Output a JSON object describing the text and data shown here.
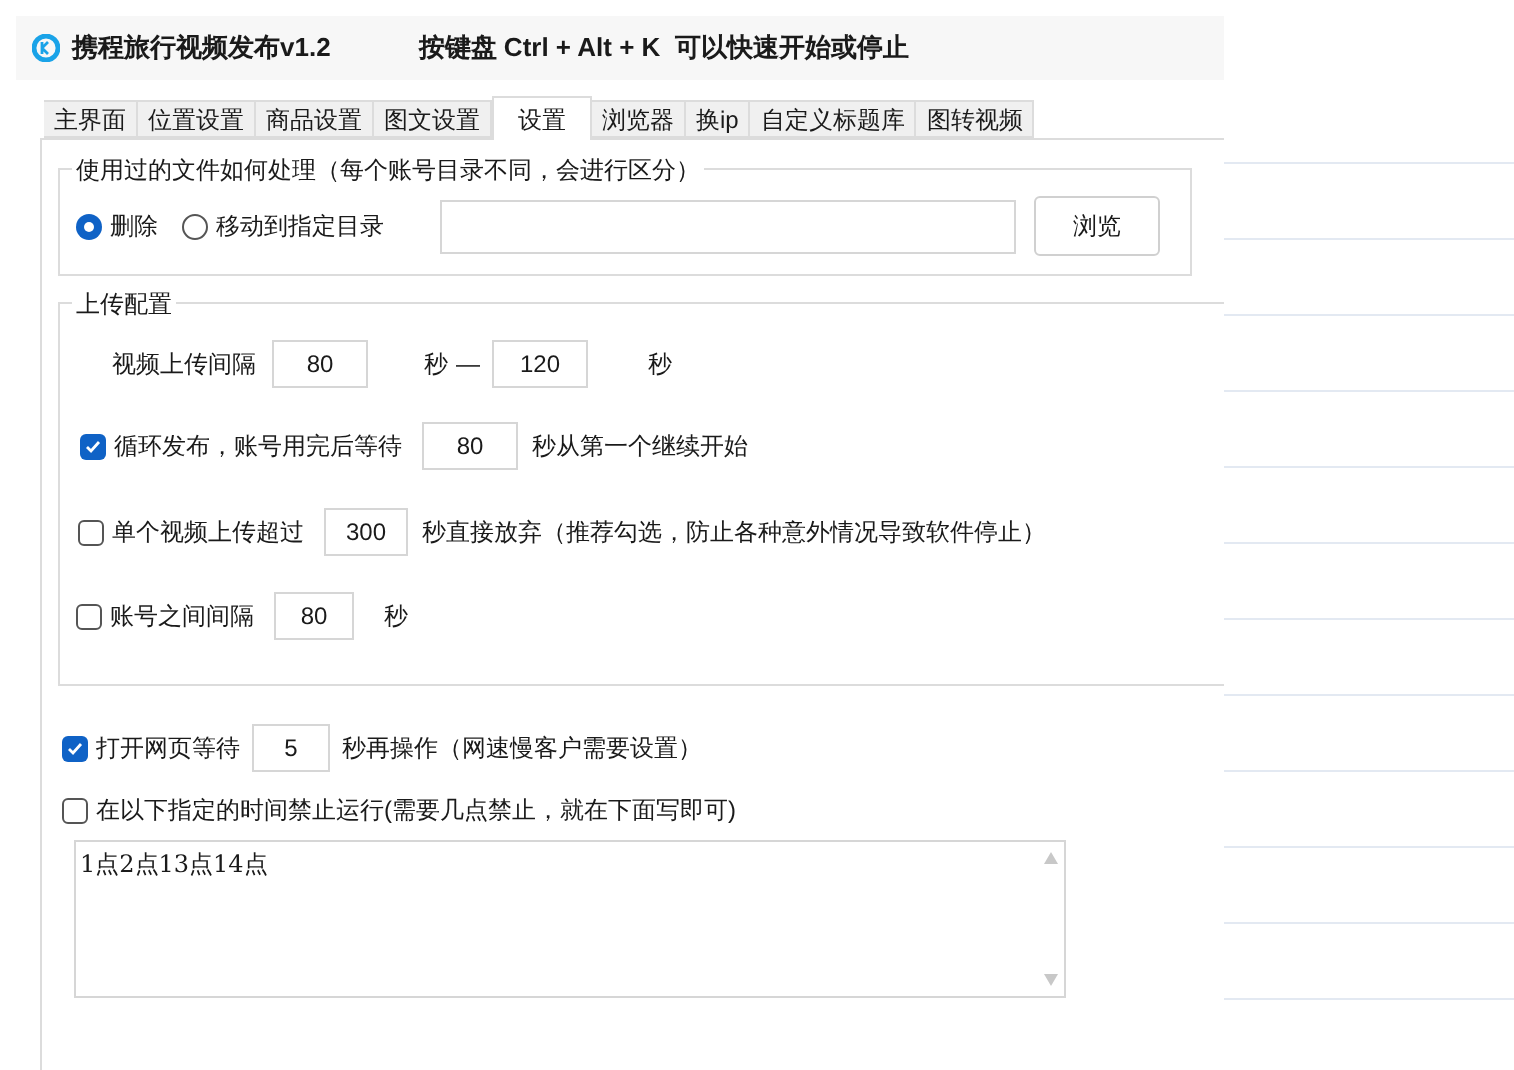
{
  "window": {
    "title": "携程旅行视频发布v1.2",
    "hotkey_hint": "按键盘 Ctrl + Alt + K  可以快速开始或停止"
  },
  "tabs": [
    {
      "label": "主界面",
      "selected": false
    },
    {
      "label": "位置设置",
      "selected": false
    },
    {
      "label": "商品设置",
      "selected": false
    },
    {
      "label": "图文设置",
      "selected": false
    },
    {
      "label": "设置",
      "selected": true
    },
    {
      "label": "浏览器",
      "selected": false
    },
    {
      "label": "换ip",
      "selected": false
    },
    {
      "label": "自定义标题库",
      "selected": false
    },
    {
      "label": "图转视频",
      "selected": false
    }
  ],
  "used_files": {
    "legend": "使用过的文件如何处理（每个账号目录不同，会进行区分）",
    "options": [
      {
        "label": "删除",
        "selected": true
      },
      {
        "label": "移动到指定目录",
        "selected": false
      }
    ],
    "browse_button": "浏览"
  },
  "upload_config": {
    "legend": "上传配置",
    "rows": [
      {
        "kind": "range",
        "label": "视频上传间隔",
        "from": "80",
        "unit_1": "秒",
        "separator": "—",
        "to": "120",
        "unit_2": "秒"
      },
      {
        "kind": "checkbox",
        "checked": true,
        "label": "循环发布，账号用完后等待",
        "value": "80",
        "suffix": "秒从第一个继续开始"
      },
      {
        "kind": "checkbox",
        "checked": false,
        "label": "单个视频上传超过",
        "value": "300",
        "suffix": "秒直接放弃（推荐勾选，防止各种意外情况导致软件停止）"
      },
      {
        "kind": "checkbox",
        "checked": false,
        "label": "账号之间间隔",
        "value": "80",
        "suffix": "秒"
      }
    ]
  },
  "page_wait": {
    "checked": true,
    "label": "打开网页等待",
    "value": "5",
    "suffix": "秒再操作（网速慢客户需要设置）"
  },
  "forbid_time": {
    "checked": false,
    "label": "在以下指定的时间禁止运行(需要几点禁止，就在下面写即可)",
    "text": "1点2点13点14点"
  }
}
